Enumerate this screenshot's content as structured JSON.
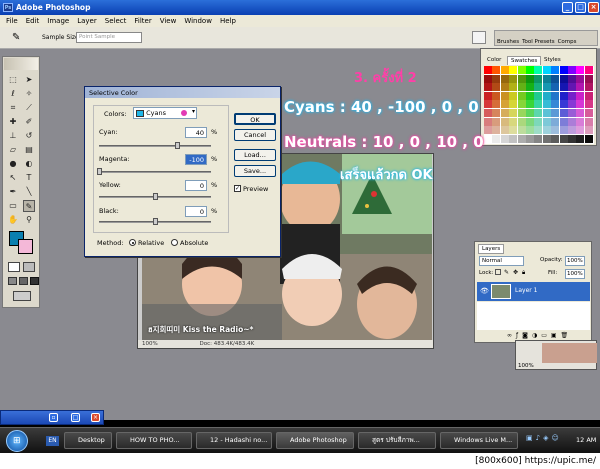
{
  "window": {
    "title": "Adobe Photoshop"
  },
  "menu": [
    "File",
    "Edit",
    "Image",
    "Layer",
    "Select",
    "Filter",
    "View",
    "Window",
    "Help"
  ],
  "options_bar": {
    "sample_size_label": "Sample Size:",
    "sample_size_value": "Point Sample"
  },
  "palette_well": [
    "Brushes",
    "Tool Presets",
    "Comps"
  ],
  "dialog": {
    "title": "Selective Color",
    "colors_label": "Colors:",
    "colors_value": "Cyans",
    "fields": [
      {
        "label": "Cyan:",
        "value": "40",
        "unit": "%",
        "level": 0.7
      },
      {
        "label": "Magenta:",
        "value": "-100",
        "unit": "%",
        "level": 0.0
      },
      {
        "label": "Yellow:",
        "value": "0",
        "unit": "%",
        "level": 0.5
      },
      {
        "label": "Black:",
        "value": "0",
        "unit": "%",
        "level": 0.5
      }
    ],
    "buttons": {
      "ok": "OK",
      "cancel": "Cancel",
      "load": "Load...",
      "save": "Save..."
    },
    "preview_label": "Preview",
    "method_label": "Method:",
    "relative_label": "Relative",
    "absolute_label": "Absolute"
  },
  "overlay": {
    "step": "3. ครั้งที่ 2",
    "cyans": "Cyans : 40 , -100 , 0 , 0",
    "neutrals": "Neutrals : 10 , 0 , 10 , 0",
    "done": "เสร็จแล้วกด OK",
    "photo_caption": "ฮ지희띠미 Kiss the Radio~*"
  },
  "canvas_status": {
    "zoom": "100%",
    "doc": "Doc: 483.4K/483.4K"
  },
  "swatch_panel": {
    "tabs": [
      "Color",
      "Swatches",
      "Styles"
    ]
  },
  "layers_panel": {
    "title": "Layers",
    "blend_mode": "Normal",
    "opacity_label": "Opacity:",
    "opacity_value": "100%",
    "lock_label": "Lock:",
    "fill_label": "Fill:",
    "fill_value": "100%",
    "layer_name": "Layer 1"
  },
  "small_zoom": "100%",
  "taskbar": {
    "lang": "EN",
    "items": [
      "Desktop",
      "HOW TO PHO...",
      "12 - Hadashi no...",
      "Adobe Photoshop",
      "สูตร ปรับสีภาพ...",
      "Windows Live M..."
    ],
    "clock": "12 AM"
  },
  "footer": "[800x600] https://upic.me/"
}
